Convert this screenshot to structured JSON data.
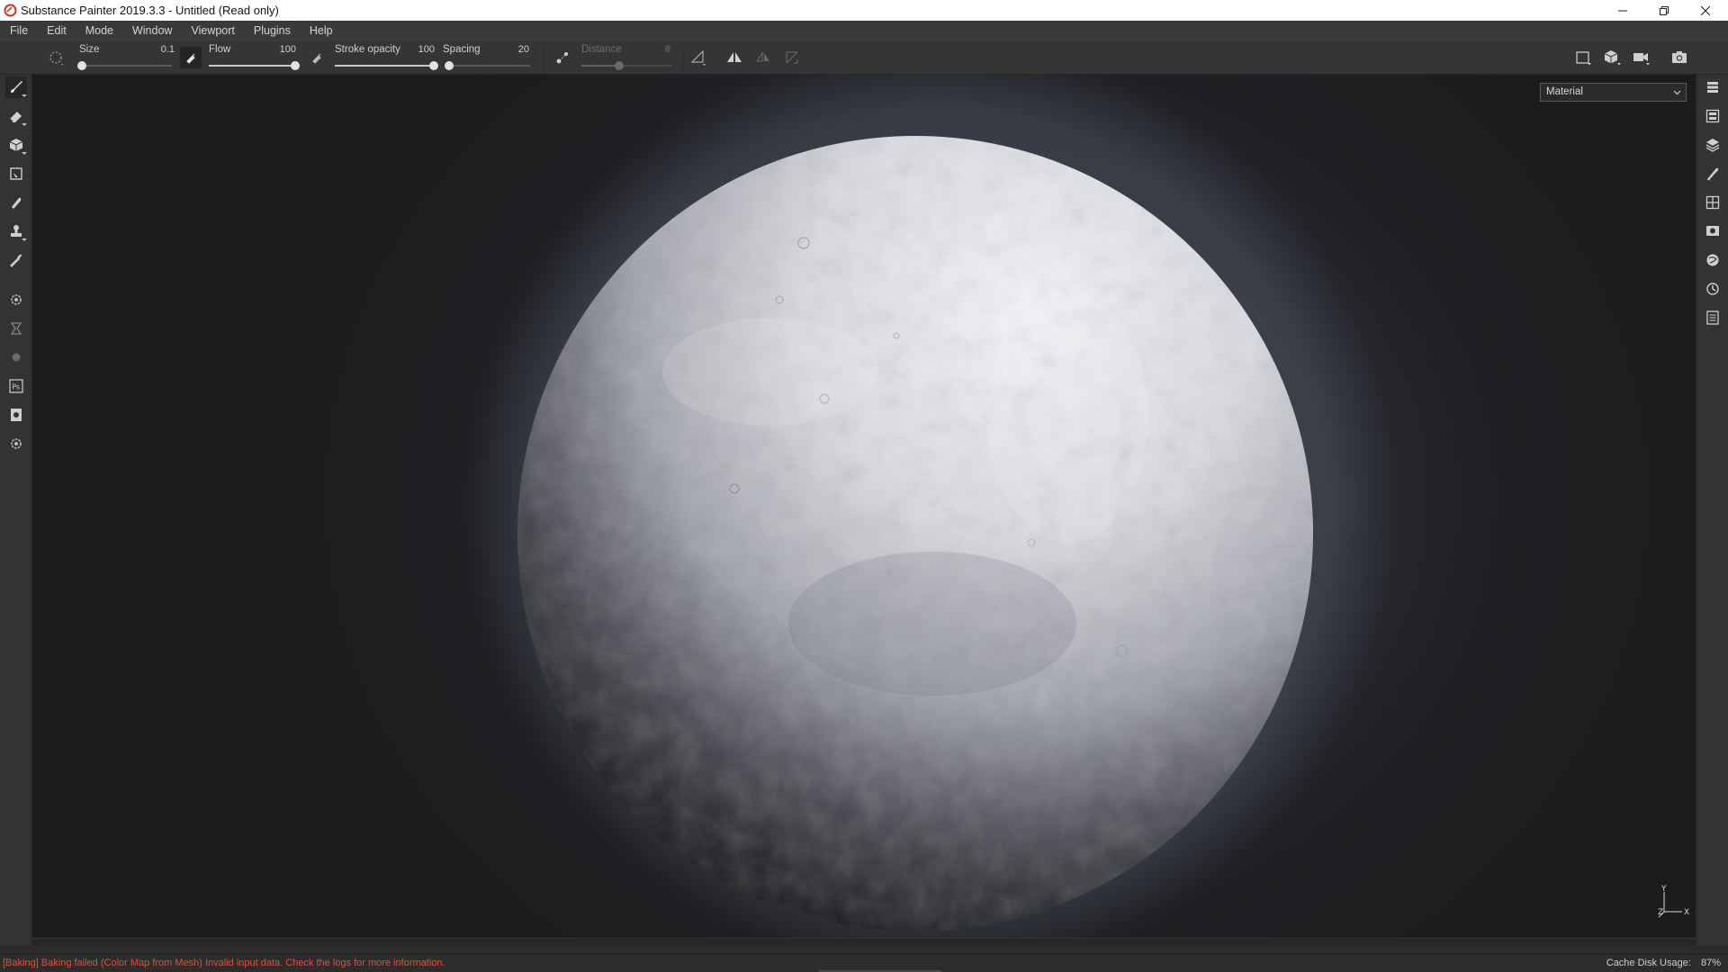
{
  "window": {
    "title": "Substance Painter 2019.3.3 - Untitled (Read only)",
    "minimize_icon": "minimize-icon",
    "restore_icon": "restore-icon",
    "close_icon": "close-icon"
  },
  "menu": [
    "File",
    "Edit",
    "Mode",
    "Window",
    "Viewport",
    "Plugins",
    "Help"
  ],
  "toolbar": {
    "brush_shape_icon": "brush-shape-icon",
    "size": {
      "label": "Size",
      "value": "0.1",
      "fraction": 0.0
    },
    "flow": {
      "label": "Flow",
      "value": "100",
      "fraction": 1.0
    },
    "stroke_opacity": {
      "label": "Stroke opacity",
      "value": "100",
      "fraction": 1.0
    },
    "spacing": {
      "label": "Spacing",
      "value": "20",
      "fraction": 0.04
    },
    "distance": {
      "label": "Distance",
      "value": "8",
      "fraction": 0.42,
      "disabled": true
    },
    "right_icons": [
      "viewport-2d-icon",
      "viewport-3d-icon",
      "camera-icon",
      "screenshot-icon"
    ]
  },
  "left_tools": [
    "paint-brush-icon",
    "eraser-icon",
    "projection-icon",
    "polygon-fill-icon",
    "smudge-icon",
    "clone-stamp-icon",
    "color-picker-icon",
    "bake-settings-icon",
    "iray-icon",
    "plugin-icon",
    "photoshop-icon",
    "export-icon",
    "settings-icon"
  ],
  "right_panels": [
    "layers-stack-icon",
    "texture-set-list-icon",
    "layers-icon",
    "properties-icon",
    "texture-set-settings-icon",
    "display-settings-icon",
    "shelf-icon",
    "history-icon",
    "log-icon"
  ],
  "viewport": {
    "channel_select": "Material",
    "axis_labels": {
      "y": "Y",
      "z": "Z",
      "x": "X"
    },
    "colors": {
      "moon_light": "#f2f3f6",
      "moon_mid": "#9a9ca4",
      "moon_shadow": "#0b0b0d",
      "background_glow": "#3c3f4c"
    }
  },
  "status": {
    "message": "[Baking] Baking failed (Color Map from Mesh) Invalid input data. Check the logs for more information.",
    "cache": "Cache Disk Usage:",
    "cache_value": "87%",
    "message_color": "#e0503a"
  }
}
